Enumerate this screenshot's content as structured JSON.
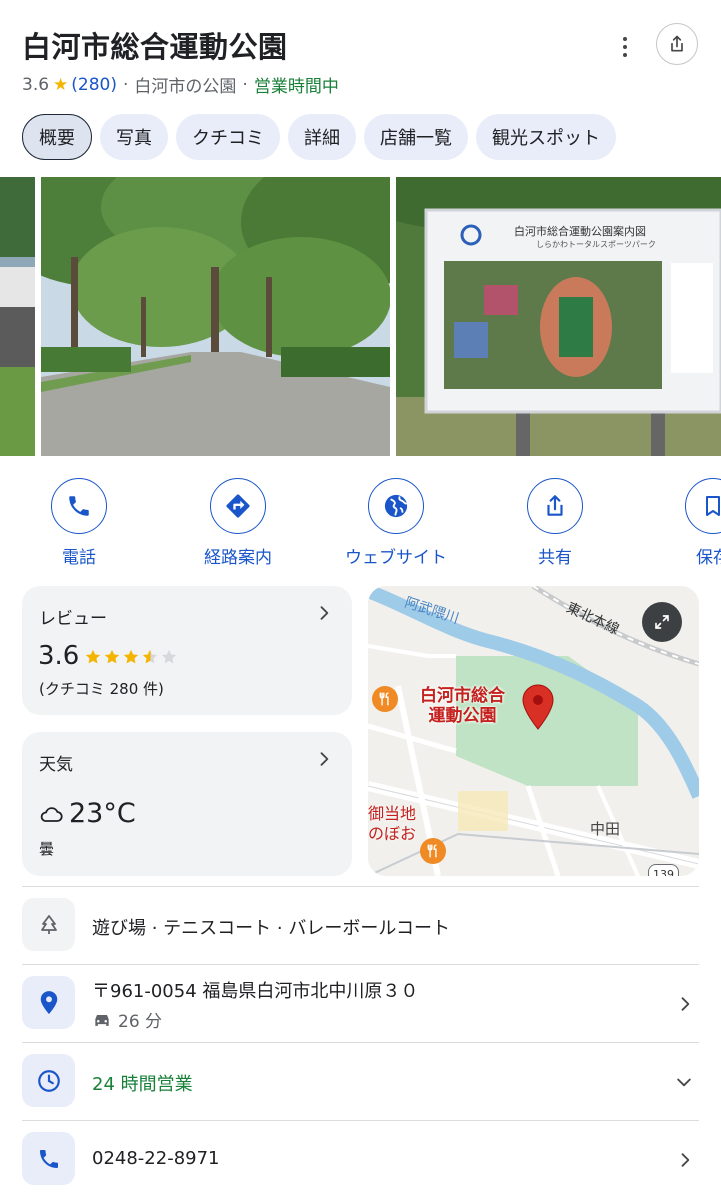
{
  "place": {
    "name": "白河市総合運動公園",
    "rating": "3.6",
    "review_count": "(280)",
    "category": "白河市の公園",
    "status": "営業時間中",
    "separator": "·"
  },
  "tabs": [
    {
      "label": "概要",
      "active": true
    },
    {
      "label": "写真"
    },
    {
      "label": "クチコミ"
    },
    {
      "label": "詳細"
    },
    {
      "label": "店舗一覧"
    },
    {
      "label": "観光スポット"
    }
  ],
  "photos": {
    "sign_title": "白河市総合運動公園案内図",
    "sign_subtitle": "しらかわトータルスポーツパーク"
  },
  "actions": [
    {
      "label": "電話",
      "icon": "phone-icon"
    },
    {
      "label": "経路案内",
      "icon": "directions-icon"
    },
    {
      "label": "ウェブサイト",
      "icon": "globe-icon"
    },
    {
      "label": "共有",
      "icon": "share-icon"
    },
    {
      "label": "保存",
      "icon": "bookmark-icon"
    }
  ],
  "review_card": {
    "title": "レビュー",
    "rating": "3.6",
    "stars_value": 3.6,
    "count_text": "(クチコミ 280 件)"
  },
  "weather_card": {
    "title": "天気",
    "temperature": "23°C",
    "condition": "曇"
  },
  "map": {
    "river_label": "阿武隈川",
    "rail_label": "東北本線",
    "pin_label_line1": "白河市総合",
    "pin_label_line2": "運動公園",
    "poi_label_line1": "御当地",
    "poi_label_line2": "のぼお",
    "area_label": "中田",
    "route_label": "139",
    "pin_color": "#d93025"
  },
  "info_rows": {
    "amenities": "遊び場 · テニスコート · バレーボールコート",
    "address": "〒961-0054 福島県白河市北中川原３０",
    "drive_time": "26 分",
    "hours": "24 時間営業",
    "phone": "0248-22-8971"
  },
  "colors": {
    "accent": "#1a56c9",
    "open_green": "#188038",
    "star": "#f4b400"
  }
}
